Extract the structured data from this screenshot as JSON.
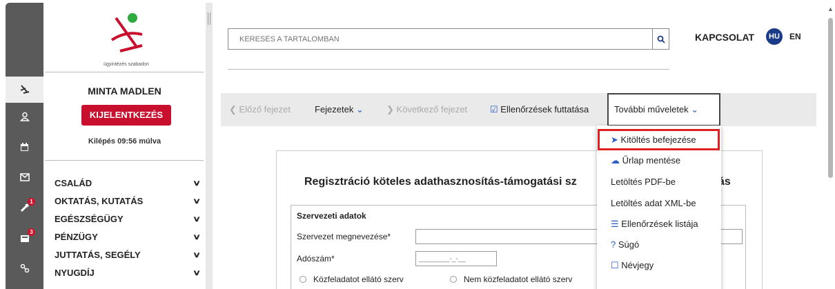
{
  "rail": {
    "icons": [
      "skier-logo-icon",
      "user-icon",
      "calendar-icon",
      "mail-icon",
      "wrench-icon",
      "inbox-icon",
      "link-icon"
    ],
    "badges": {
      "wrench": "1",
      "inbox": "3"
    }
  },
  "sidebar": {
    "logo_text": "ügyintézés szabadon",
    "user_name": "MINTA MADLEN",
    "logout_label": "KIJELENTKEZÉS",
    "logout_timer": "Kilépés 09:56 múlva",
    "nav": [
      {
        "label": "CSALÁD"
      },
      {
        "label": "OKTATÁS, KUTATÁS"
      },
      {
        "label": "EGÉSZSÉGÜGY"
      },
      {
        "label": "PÉNZÜGY"
      },
      {
        "label": "JUTTATÁS, SEGÉLY"
      },
      {
        "label": "NYUGDÍJ"
      }
    ]
  },
  "header": {
    "search_placeholder": "KERESÉS A TARTALOMBAN",
    "contact": "KAPCSOLAT",
    "lang_hu": "HU",
    "lang_en": "EN"
  },
  "toolbar": {
    "prev": "Előző fejezet",
    "chapters": "Fejezetek",
    "next": "Következő fejezet",
    "run_checks": "Ellenőrzések futtatása",
    "more": "További műveletek"
  },
  "form": {
    "title": "Regisztráció köteles adathasznosítás-támogatási sz",
    "title_end": "ás",
    "section_title": "Szervezeti adatok",
    "org_name_label": "Szervezet megnevezése*",
    "tax_label": "Adószám*",
    "tax_placeholder": "________-_-__",
    "radio_public": "Közfeladatot ellátó szerv",
    "radio_nonpublic": "Nem közfeladatot ellátó szerv"
  },
  "dropdown": {
    "items": [
      {
        "label": "Kitöltés befejezése",
        "icon": "send-icon"
      },
      {
        "label": "Űrlap mentése",
        "icon": "cloud-upload-icon"
      },
      {
        "label": "Letöltés PDF-be",
        "icon": ""
      },
      {
        "label": "Letöltés adat XML-be",
        "icon": ""
      },
      {
        "label": "Ellenőrzések listája",
        "icon": "list-icon"
      },
      {
        "label": "Súgó",
        "icon": "help-icon"
      },
      {
        "label": "Névjegy",
        "icon": "square-icon"
      }
    ]
  },
  "colors": {
    "accent_red": "#c8102e",
    "highlight_red": "#e02020",
    "link_blue": "#2a5bc4",
    "lang_badge": "#1a3a8a"
  }
}
